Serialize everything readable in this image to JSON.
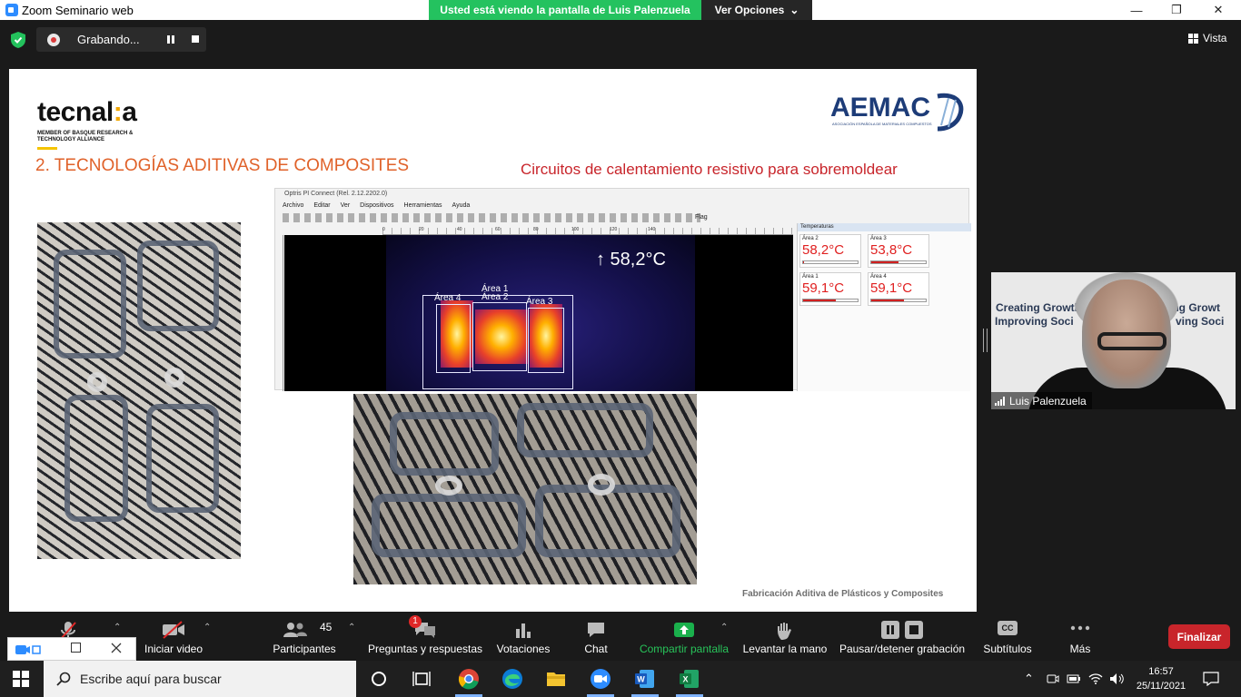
{
  "window": {
    "title": "Zoom Seminario web",
    "minimize": "—",
    "maximize": "❐",
    "close": "✕"
  },
  "share_banner": {
    "text": "Usted está viendo la pantalla de Luis Palenzuela",
    "options_label": "Ver Opciones",
    "options_chevron": "⌄"
  },
  "recording": {
    "label": "Grabando..."
  },
  "view_button": {
    "label": "Vista",
    "icon": "grid-icon"
  },
  "slide": {
    "logo_left": {
      "pre": "tecnal",
      "colon": ":",
      "post": "a",
      "sub": "MEMBER OF BASQUE RESEARCH & TECHNOLOGY ALLIANCE"
    },
    "logo_right": "AEMAC",
    "logo_right_sub": "ASOCIACIÓN ESPAÑOLA DE MATERIALES COMPUESTOS",
    "heading": "2. TECNOLOGÍAS ADITIVAS DE COMPOSITES",
    "subheading": "Circuitos de calentamiento resistivo para sobremoldear",
    "footer": "Fabricación Aditiva de Plásticos y Composites",
    "thermal": {
      "window_title": "Optris PI Connect (Rel. 2.12.2202.0)",
      "menu": [
        "Archivo",
        "Editar",
        "Ver",
        "Dispositivos",
        "Herramientas",
        "Ayuda"
      ],
      "flag": "Flag",
      "ruler_ticks": [
        "0",
        "20",
        "40",
        "60",
        "80",
        "100",
        "120",
        "140"
      ],
      "max_temp": "↑ 58,2°C",
      "areas": [
        "Área 1",
        "Área 2",
        "Área 3",
        "Área 4"
      ],
      "panel_title": "Temperaturas",
      "readings": [
        {
          "name": "Área 2",
          "value": "58,2°C",
          "level": 0.02
        },
        {
          "name": "Área 3",
          "value": "53,8°C",
          "level": 0.5
        },
        {
          "name": "Área 1",
          "value": "59,1°C",
          "level": 0.6
        },
        {
          "name": "Área 4",
          "value": "59,1°C",
          "level": 0.6
        }
      ]
    }
  },
  "participant_video": {
    "name": "Luis Palenzuela",
    "bg_line1": "Creating Growth",
    "bg_line2": "Improving Soci",
    "bg_line3": "ing Growt",
    "bg_line4": "ving Soci"
  },
  "controls": {
    "audio": {
      "icon": "microphone-muted-icon"
    },
    "video": {
      "label": "Iniciar video",
      "icon": "video-off-icon"
    },
    "participants": {
      "label": "Participantes",
      "count": "45"
    },
    "qa": {
      "label": "Preguntas y respuestas",
      "badge": "1"
    },
    "polls": {
      "label": "Votaciones"
    },
    "chat": {
      "label": "Chat"
    },
    "share": {
      "label": "Compartir pantalla"
    },
    "raise_hand": {
      "label": "Levantar la mano"
    },
    "recording": {
      "label": "Pausar/detener grabación"
    },
    "subtitles": {
      "label": "Subtítulos",
      "badge": "CC"
    },
    "more": {
      "label": "Más"
    },
    "end": {
      "label": "Finalizar"
    }
  },
  "taskbar": {
    "search_placeholder": "Escribe aquí para buscar",
    "time": "16:57",
    "date": "25/11/2021"
  },
  "colors": {
    "zoom_blue": "#2d8cff",
    "share_green": "#24c25f",
    "end_red": "#c8252b",
    "heading_orange": "#e0622a",
    "subheading_red": "#c8252b"
  }
}
